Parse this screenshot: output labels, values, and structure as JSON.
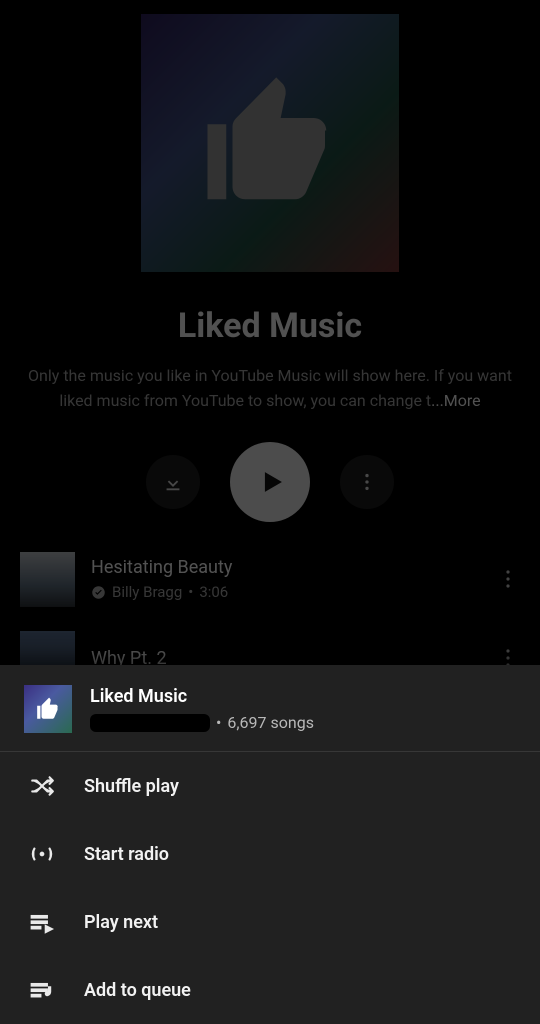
{
  "playlist": {
    "title": "Liked Music",
    "description": "Only the music you like in YouTube Music will show here. If you want liked music from YouTube to show, you can change t",
    "more_label": "...More"
  },
  "tracks": [
    {
      "title": "Hesitating Beauty",
      "artist": "Billy Bragg",
      "duration": "3:06",
      "verified": true
    },
    {
      "title": "Why Pt. 2",
      "artist": "",
      "duration": "",
      "verified": false
    }
  ],
  "sheet": {
    "title": "Liked Music",
    "count_label": "6,697 songs",
    "items": [
      {
        "icon": "shuffle-icon",
        "label": "Shuffle play"
      },
      {
        "icon": "radio-icon",
        "label": "Start radio"
      },
      {
        "icon": "play-next-icon",
        "label": "Play next"
      },
      {
        "icon": "add-queue-icon",
        "label": "Add to queue"
      }
    ]
  }
}
